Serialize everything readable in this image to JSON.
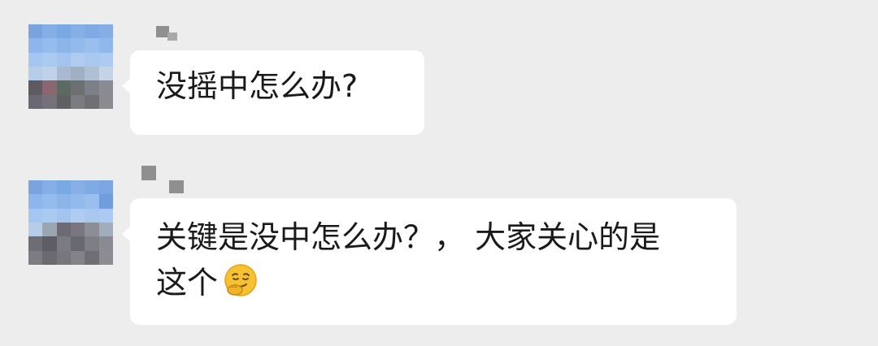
{
  "messages": [
    {
      "sender_name": "▪",
      "text": "没摇中怎么办?"
    },
    {
      "sender_name": "▪ ▪",
      "text_line1": "关键是没中怎么办？， 大家关心的是",
      "text_line2": "这个",
      "emoji": "thinking-smirk-face-icon"
    }
  ],
  "colors": {
    "background": "#ededed",
    "bubble": "#ffffff",
    "text": "#1a1a1a",
    "emoji_yellow": "#f7c232"
  }
}
